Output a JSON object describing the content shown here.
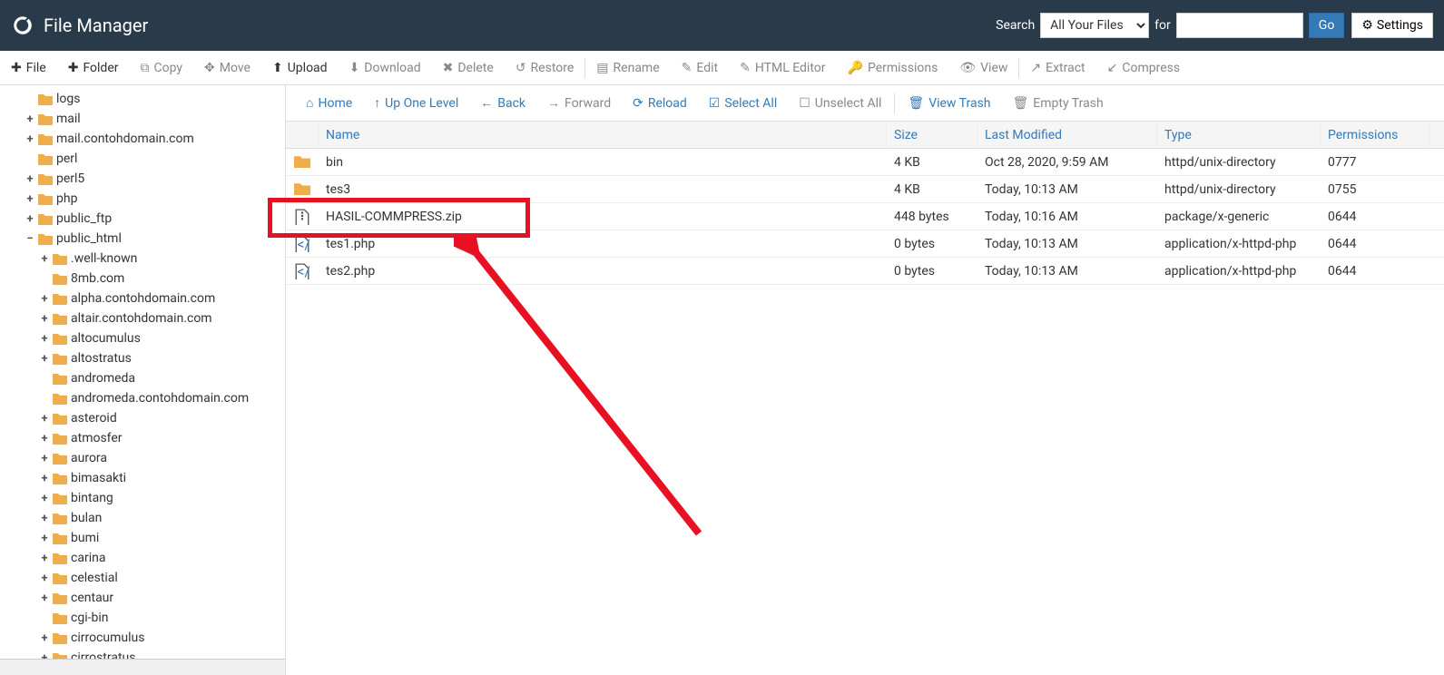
{
  "header": {
    "title": "File Manager",
    "search_label": "Search",
    "search_scope": "All Your Files",
    "for_label": "for",
    "go_label": "Go",
    "settings_label": "Settings"
  },
  "toolbar": {
    "file": "File",
    "folder": "Folder",
    "copy": "Copy",
    "move": "Move",
    "upload": "Upload",
    "download": "Download",
    "delete": "Delete",
    "restore": "Restore",
    "rename": "Rename",
    "edit": "Edit",
    "html_editor": "HTML Editor",
    "permissions": "Permissions",
    "view": "View",
    "extract": "Extract",
    "compress": "Compress"
  },
  "nav": {
    "home": "Home",
    "up": "Up One Level",
    "back": "Back",
    "forward": "Forward",
    "reload": "Reload",
    "select_all": "Select All",
    "unselect_all": "Unselect All",
    "view_trash": "View Trash",
    "empty_trash": "Empty Trash"
  },
  "columns": {
    "name": "Name",
    "size": "Size",
    "mod": "Last Modified",
    "type": "Type",
    "perm": "Permissions"
  },
  "tree": [
    {
      "label": "logs",
      "indent": 1,
      "expander": ""
    },
    {
      "label": "mail",
      "indent": 1,
      "expander": "+"
    },
    {
      "label": "mail.contohdomain.com",
      "indent": 1,
      "expander": "+"
    },
    {
      "label": "perl",
      "indent": 1,
      "expander": ""
    },
    {
      "label": "perl5",
      "indent": 1,
      "expander": "+"
    },
    {
      "label": "php",
      "indent": 1,
      "expander": "+"
    },
    {
      "label": "public_ftp",
      "indent": 1,
      "expander": "+"
    },
    {
      "label": "public_html",
      "indent": 1,
      "expander": "−",
      "selected": true
    },
    {
      "label": ".well-known",
      "indent": 2,
      "expander": "+"
    },
    {
      "label": "8mb.com",
      "indent": 2,
      "expander": ""
    },
    {
      "label": "alpha.contohdomain.com",
      "indent": 2,
      "expander": "+"
    },
    {
      "label": "altair.contohdomain.com",
      "indent": 2,
      "expander": "+"
    },
    {
      "label": "altocumulus",
      "indent": 2,
      "expander": "+"
    },
    {
      "label": "altostratus",
      "indent": 2,
      "expander": "+"
    },
    {
      "label": "andromeda",
      "indent": 2,
      "expander": ""
    },
    {
      "label": "andromeda.contohdomain.com",
      "indent": 2,
      "expander": ""
    },
    {
      "label": "asteroid",
      "indent": 2,
      "expander": "+"
    },
    {
      "label": "atmosfer",
      "indent": 2,
      "expander": "+"
    },
    {
      "label": "aurora",
      "indent": 2,
      "expander": "+"
    },
    {
      "label": "bimasakti",
      "indent": 2,
      "expander": "+"
    },
    {
      "label": "bintang",
      "indent": 2,
      "expander": "+"
    },
    {
      "label": "bulan",
      "indent": 2,
      "expander": "+"
    },
    {
      "label": "bumi",
      "indent": 2,
      "expander": "+"
    },
    {
      "label": "carina",
      "indent": 2,
      "expander": "+"
    },
    {
      "label": "celestial",
      "indent": 2,
      "expander": "+"
    },
    {
      "label": "centaur",
      "indent": 2,
      "expander": "+"
    },
    {
      "label": "cgi-bin",
      "indent": 2,
      "expander": ""
    },
    {
      "label": "cirrocumulus",
      "indent": 2,
      "expander": "+"
    },
    {
      "label": "cirrostratus",
      "indent": 2,
      "expander": "+"
    }
  ],
  "rows": [
    {
      "icon": "folder",
      "name": "bin",
      "size": "4 KB",
      "mod": "Oct 28, 2020, 9:59 AM",
      "type": "httpd/unix-directory",
      "perm": "0777"
    },
    {
      "icon": "folder",
      "name": "tes3",
      "size": "4 KB",
      "mod": "Today, 10:13 AM",
      "type": "httpd/unix-directory",
      "perm": "0755"
    },
    {
      "icon": "zip",
      "name": "HASIL-COMMPRESS.zip",
      "size": "448 bytes",
      "mod": "Today, 10:16 AM",
      "type": "package/x-generic",
      "perm": "0644"
    },
    {
      "icon": "php",
      "name": "tes1.php",
      "size": "0 bytes",
      "mod": "Today, 10:13 AM",
      "type": "application/x-httpd-php",
      "perm": "0644"
    },
    {
      "icon": "php",
      "name": "tes2.php",
      "size": "0 bytes",
      "mod": "Today, 10:13 AM",
      "type": "application/x-httpd-php",
      "perm": "0644"
    }
  ]
}
